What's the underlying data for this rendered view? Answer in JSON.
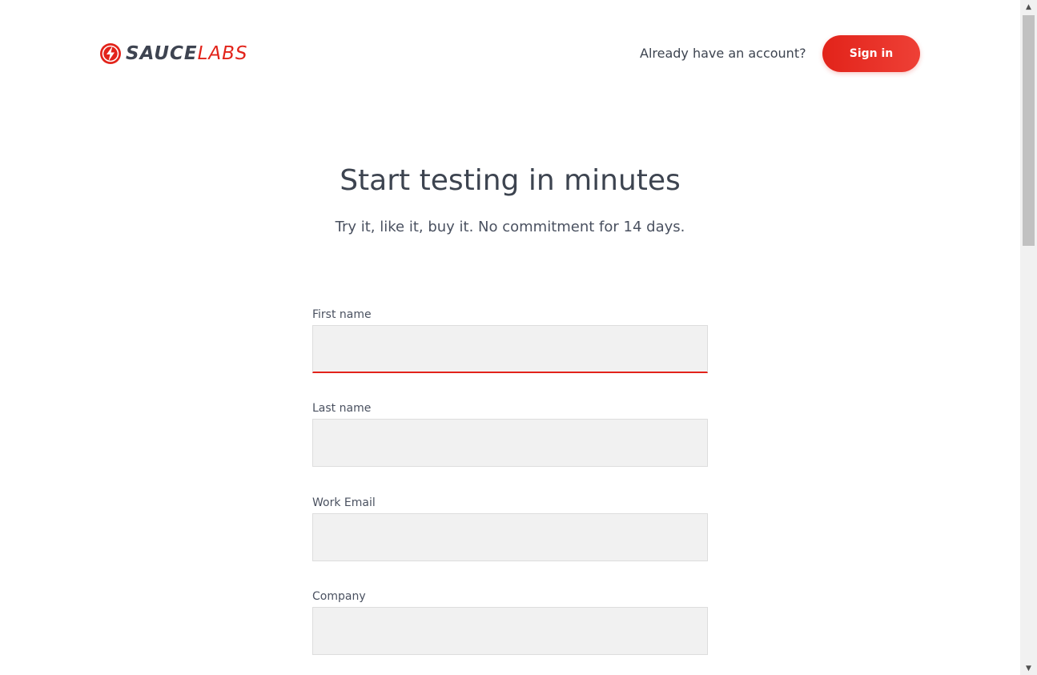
{
  "header": {
    "logo": {
      "primary": "SAUCE",
      "secondary": "LABS",
      "brand_color": "#e2231a"
    },
    "account_prompt": "Already have an account?",
    "signin_label": "Sign in"
  },
  "hero": {
    "title": "Start testing in minutes",
    "subtitle": "Try it, like it, buy it. No commitment for 14 days."
  },
  "form": {
    "fields": [
      {
        "label": "First name",
        "value": ""
      },
      {
        "label": "Last name",
        "value": ""
      },
      {
        "label": "Work Email",
        "value": ""
      },
      {
        "label": "Company",
        "value": ""
      }
    ]
  },
  "icons": {
    "logo": "sauce-labs-bolt-icon",
    "scroll_up": "chevron-up-icon",
    "scroll_down": "chevron-down-icon"
  }
}
